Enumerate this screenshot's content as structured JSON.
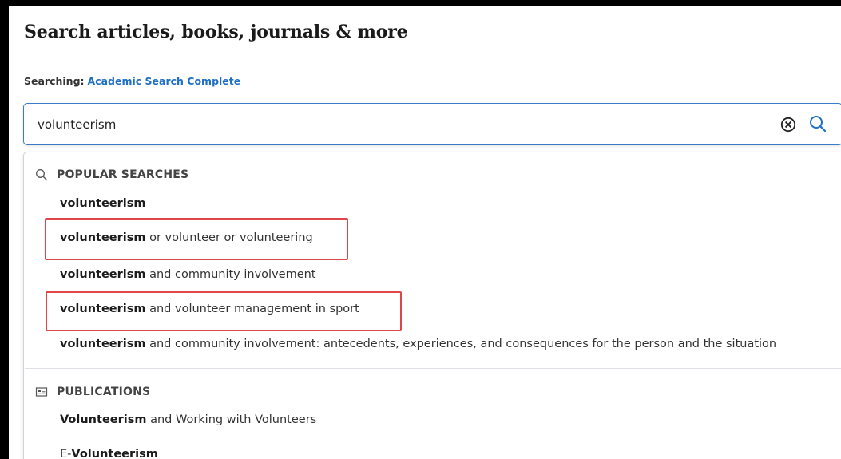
{
  "header": {
    "title": "Search articles, books, journals & more"
  },
  "searching": {
    "label": "Searching:",
    "database": "Academic Search Complete"
  },
  "search": {
    "value": "volunteerism",
    "clear_icon": "clear-circle-icon",
    "search_icon": "search-icon"
  },
  "popular": {
    "header": "POPULAR SEARCHES",
    "icon": "search-icon",
    "items": [
      {
        "bold": "volunteerism",
        "rest": ""
      },
      {
        "bold": "volunteerism",
        "rest": " or volunteer or volunteering"
      },
      {
        "bold": "volunteerism",
        "rest": " and community involvement"
      },
      {
        "bold": "volunteerism",
        "rest": " and volunteer management in sport"
      },
      {
        "bold": "volunteerism",
        "rest": " and community involvement: antecedents, experiences, and consequences for the person and the situation"
      }
    ]
  },
  "publications": {
    "header": "PUBLICATIONS",
    "icon": "newspaper-icon",
    "items": [
      {
        "pre": "",
        "bold": "Volunteerism",
        "rest": " and Working with Volunteers"
      },
      {
        "pre": "E-",
        "bold": "Volunteerism",
        "rest": ""
      }
    ]
  },
  "colors": {
    "accent": "#1f6fc4",
    "highlight": "#e0454a"
  }
}
